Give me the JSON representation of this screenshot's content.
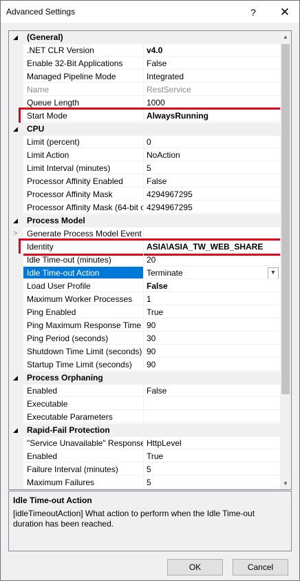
{
  "window": {
    "title": "Advanced Settings",
    "help_glyph": "?",
    "close_glyph": "✕"
  },
  "property_grid": {
    "rows": [
      {
        "type": "category",
        "name": "(General)",
        "expanded": true
      },
      {
        "type": "prop",
        "name": ".NET CLR Version",
        "value": "v4.0",
        "bold": true
      },
      {
        "type": "prop",
        "name": "Enable 32-Bit Applications",
        "value": "False"
      },
      {
        "type": "prop",
        "name": "Managed Pipeline Mode",
        "value": "Integrated"
      },
      {
        "type": "prop",
        "name": "Name",
        "value": "RestService",
        "disabled": true
      },
      {
        "type": "prop",
        "name": "Queue Length",
        "value": "1000"
      },
      {
        "type": "prop",
        "name": "Start Mode",
        "value": "AlwaysRunning",
        "bold": true,
        "highlighted": true
      },
      {
        "type": "category",
        "name": "CPU",
        "expanded": true
      },
      {
        "type": "prop",
        "name": "Limit (percent)",
        "value": "0"
      },
      {
        "type": "prop",
        "name": "Limit Action",
        "value": "NoAction"
      },
      {
        "type": "prop",
        "name": "Limit Interval (minutes)",
        "value": "5"
      },
      {
        "type": "prop",
        "name": "Processor Affinity Enabled",
        "value": "False"
      },
      {
        "type": "prop",
        "name": "Processor Affinity Mask",
        "value": "4294967295"
      },
      {
        "type": "prop",
        "name": "Processor Affinity Mask (64-bit o",
        "value": "4294967295"
      },
      {
        "type": "category",
        "name": "Process Model",
        "expanded": true
      },
      {
        "type": "prop",
        "name": "Generate Process Model Event L",
        "value": "",
        "expandable": true
      },
      {
        "type": "prop",
        "name": "Identity",
        "value": "ASIA\\ASIA_TW_WEB_SHARE",
        "bold": true,
        "highlighted": true
      },
      {
        "type": "prop",
        "name": "Idle Time-out (minutes)",
        "value": "20"
      },
      {
        "type": "prop",
        "name": "Idle Time-out Action",
        "value": "Terminate",
        "selected": true,
        "dropdown": true
      },
      {
        "type": "prop",
        "name": "Load User Profile",
        "value": "False",
        "bold": true
      },
      {
        "type": "prop",
        "name": "Maximum Worker Processes",
        "value": "1"
      },
      {
        "type": "prop",
        "name": "Ping Enabled",
        "value": "True"
      },
      {
        "type": "prop",
        "name": "Ping Maximum Response Time (",
        "value": "90"
      },
      {
        "type": "prop",
        "name": "Ping Period (seconds)",
        "value": "30"
      },
      {
        "type": "prop",
        "name": "Shutdown Time Limit (seconds)",
        "value": "90"
      },
      {
        "type": "prop",
        "name": "Startup Time Limit (seconds)",
        "value": "90"
      },
      {
        "type": "category",
        "name": "Process Orphaning",
        "expanded": true
      },
      {
        "type": "prop",
        "name": "Enabled",
        "value": "False"
      },
      {
        "type": "prop",
        "name": "Executable",
        "value": ""
      },
      {
        "type": "prop",
        "name": "Executable Parameters",
        "value": ""
      },
      {
        "type": "category",
        "name": "Rapid-Fail Protection",
        "expanded": true
      },
      {
        "type": "prop",
        "name": "\"Service Unavailable\" Response T",
        "value": "HttpLevel"
      },
      {
        "type": "prop",
        "name": "Enabled",
        "value": "True"
      },
      {
        "type": "prop",
        "name": "Failure Interval (minutes)",
        "value": "5"
      },
      {
        "type": "prop",
        "name": "Maximum Failures",
        "value": "5"
      }
    ],
    "scroll_position": 0.0
  },
  "description": {
    "title": "Idle Time-out Action",
    "text": "[idleTimeoutAction] What action to perform when the Idle Time-out duration has been reached."
  },
  "buttons": {
    "ok_label": "OK",
    "cancel_label": "Cancel"
  },
  "colors": {
    "selection": "#0078d7",
    "highlight_box": "#e0001b"
  }
}
